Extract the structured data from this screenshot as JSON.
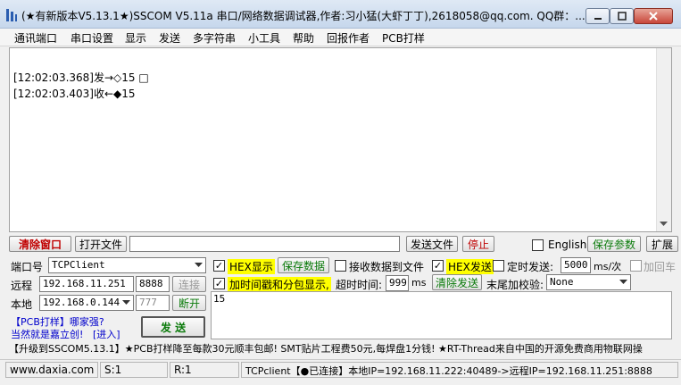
{
  "window": {
    "title": "(★有新版本V5.13.1★)SSCOM V5.11a 串口/网络数据调试器,作者:习小猛(大虾丁丁),2618058@qq.com. QQ群：..."
  },
  "menu": {
    "items": [
      "通讯端口",
      "串口设置",
      "显示",
      "发送",
      "多字符串",
      "小工具",
      "帮助",
      "回报作者",
      "PCB打样"
    ]
  },
  "receive": {
    "lines": [
      "[12:02:03.368]发→◇15 □",
      "[12:02:03.403]收←◆15"
    ]
  },
  "controls": {
    "clear_label": "清除窗口",
    "open_file_label": "打开文件",
    "file_path": "",
    "send_file_label": "发送文件",
    "stop_label": "停止",
    "english_label": "English",
    "save_params_label": "保存参数",
    "expand_label": "扩展"
  },
  "port": {
    "port_label": "端口号",
    "port_value": "TCPClient",
    "remote_label": "远程",
    "remote_ip": "192.168.11.251",
    "remote_port": "8888",
    "connect_label": "连接",
    "local_label": "本地",
    "local_ip": "192.168.0.144",
    "local_port": "777",
    "disconnect_label": "断开",
    "promo_pcb": "【PCB打样】哪家强?",
    "promo_jlc": "当然就是嘉立创!",
    "promo_enter": "[进入]",
    "send_label": "发  送"
  },
  "options": {
    "hex_display_label": "HEX显示",
    "hex_display_checked": true,
    "save_data_label": "保存数据",
    "recv_to_file_label": "接收数据到文件",
    "recv_to_file_checked": false,
    "hex_send_label": "HEX发送",
    "hex_send_checked": true,
    "timed_send_label": "定时发送:",
    "timed_send_checked": false,
    "timed_value": "5000",
    "timed_unit": "ms/次",
    "add_return_label": "加回车",
    "add_return_checked": false,
    "timestamp_label": "加时间戳和分包显示,",
    "timestamp_checked": true,
    "timeout_label": "超时时间:",
    "timeout_value": "999",
    "timeout_unit": "ms",
    "clear_send_label": "清除发送",
    "checksum_label": "末尾加校验:",
    "checksum_value": "None"
  },
  "send": {
    "text": "15"
  },
  "promo": {
    "text": "【升级到SSCOM5.13.1】★PCB打样降至每款30元顺丰包邮! SMT贴片工程费50元,每焊盘1分钱! ★RT-Thread来自中国的开源免费商用物联网操"
  },
  "status": {
    "site": "www.daxia.com",
    "sent": "S:1",
    "received": "R:1",
    "connection": "TCPclient【●已连接】本地IP=192.168.11.222:40489->远程IP=192.168.11.251:8888"
  },
  "colors": {
    "highlight": "#ffff00",
    "clear_text": "#c00000",
    "save_text": "#0a7a0a",
    "link": "#0000cc"
  }
}
